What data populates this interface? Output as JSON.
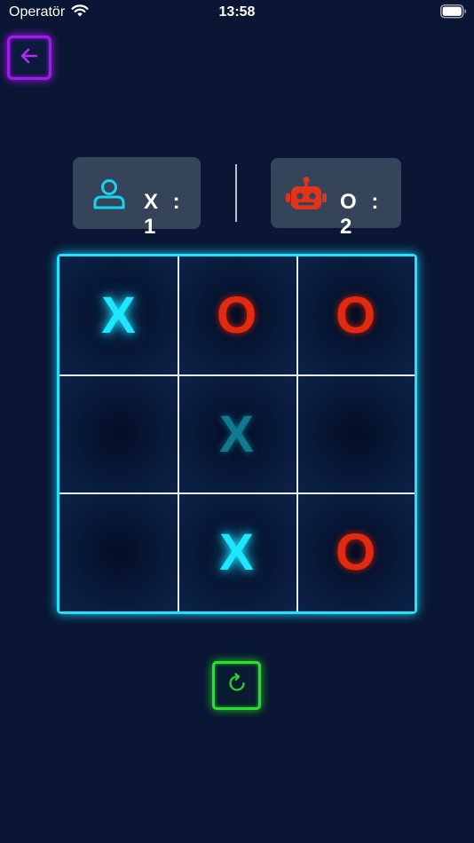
{
  "status_bar": {
    "carrier": "Operatör",
    "time": "13:58"
  },
  "header": {
    "back_icon": "arrow-left-icon"
  },
  "scores": {
    "player": {
      "icon": "person-icon",
      "text": "X : 1"
    },
    "robot": {
      "icon": "robot-icon",
      "text": "O : 2"
    }
  },
  "board": {
    "cells": [
      "X",
      "O",
      "O",
      "",
      "X",
      "",
      "",
      "X",
      "O"
    ]
  },
  "controls": {
    "restart_icon": "refresh-icon"
  },
  "colors": {
    "background": "#0a1633",
    "x_mark": "#1de7ff",
    "o_mark": "#e32a10",
    "board_border": "#1fe3ff",
    "back_button": "#a418f0",
    "restart_button": "#2ae02c"
  }
}
